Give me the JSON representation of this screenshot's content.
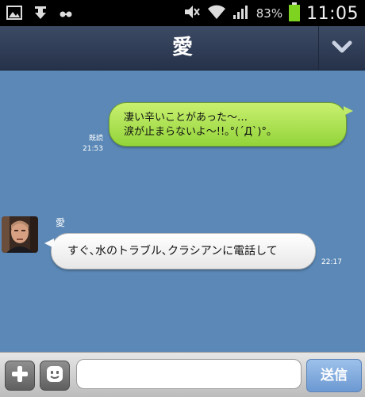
{
  "status_bar": {
    "battery_percent": "83%",
    "time": "11:05",
    "left_icons": [
      "image-icon",
      "download-icon",
      "link-icon"
    ],
    "right_icons": [
      "mute-icon",
      "wifi-icon",
      "signal-icon",
      "battery-icon"
    ],
    "battery_color": "#7ed321"
  },
  "header": {
    "title": "愛",
    "menu_icon": "chevron-down-icon"
  },
  "messages": [
    {
      "direction": "outgoing",
      "lines": [
        "凄い辛いことがあった～…",
        "涙が止まらないよ～!!｡°(´Д`)°｡"
      ],
      "read_label": "既読",
      "time": "21:53",
      "color": "#a8df4a"
    },
    {
      "direction": "incoming",
      "sender": "愛",
      "text": "すぐ､水のトラブル､クラシアンに電話して",
      "time": "22:17",
      "color": "#ffffff"
    }
  ],
  "input_bar": {
    "plus_icon": "plus-icon",
    "sticker_icon": "smiley-icon",
    "input_value": "",
    "send_label": "送信"
  },
  "colors": {
    "chat_background": "#5b88b6",
    "header_background": "#2f3b54",
    "send_button": "#7fa8dc"
  }
}
